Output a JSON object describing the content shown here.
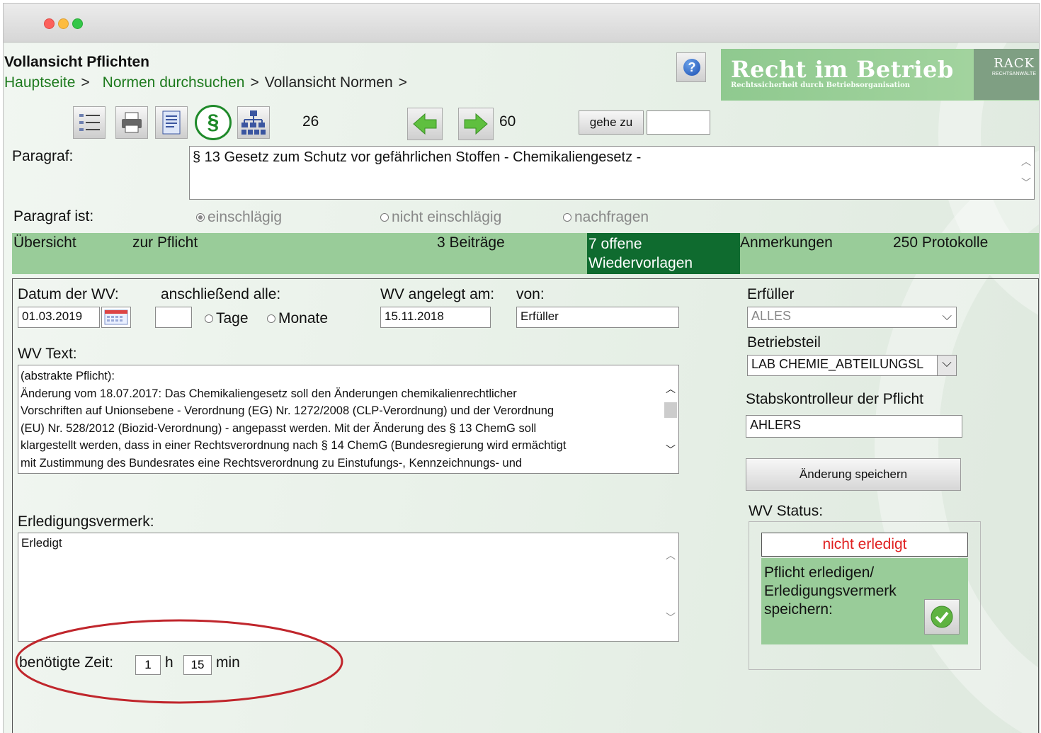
{
  "colors": {
    "accent_green": "#99cc99",
    "active_tab": "#0f6b2f",
    "link_green": "#1d7a1d",
    "status_red": "#e02020",
    "oval_red": "#c0262c"
  },
  "header": {
    "title": "Vollansicht Pflichten",
    "breadcrumb": [
      {
        "label": "Hauptseite",
        "sep": ">"
      },
      {
        "label": "Normen durchsuchen",
        "sep": ">"
      },
      {
        "label": "Vollansicht Normen",
        "sep": ">"
      }
    ],
    "help_glyph": "?",
    "logo": {
      "title": "Recht im Betrieb",
      "tagline": "Rechtssicherheit durch Betriebsorganisation",
      "brand": "RACK",
      "brand_sub": "RECHTSANWÄLTE"
    }
  },
  "toolbar": {
    "icons": [
      "list-icon",
      "printer-icon",
      "document-icon",
      "paragraph-icon",
      "org-chart-icon"
    ],
    "paragraph_symbol": "§",
    "current_number": "26",
    "total_number": "60",
    "goto_label": "gehe zu",
    "goto_value": ""
  },
  "paragraph": {
    "label": "Paragraf:",
    "value": "§ 13 Gesetz zum Schutz vor gefährlichen Stoffen - Chemikaliengesetz -",
    "status_label": "Paragraf ist:",
    "options": [
      {
        "label": "einschlägig",
        "selected": true
      },
      {
        "label": "nicht einschlägig",
        "selected": false
      },
      {
        "label": "nachfragen",
        "selected": false
      }
    ]
  },
  "tabs": [
    {
      "label": "Übersicht"
    },
    {
      "label": "zur Pflicht"
    },
    {
      "label": "3 Beiträge"
    },
    {
      "label": "7 offene Wiedervorlagen",
      "active": true
    },
    {
      "label": "Anmerkungen"
    },
    {
      "label": "250 Protokolle"
    }
  ],
  "form": {
    "date_label": "Datum der WV:",
    "date_value": "01.03.2019",
    "then_all_label": "anschließend alle:",
    "interval_value": "",
    "unit_options": [
      {
        "label": "Tage"
      },
      {
        "label": "Monate"
      }
    ],
    "created_label": "WV angelegt am:",
    "created_value": "15.11.2018",
    "from_label": "von:",
    "from_value": "Erfüller",
    "wv_text_label": "WV Text:",
    "wv_text_lines": [
      "(abstrakte Pflicht):",
      "Änderung vom 18.07.2017: Das Chemikaliengesetz soll den Änderungen chemikalienrechtlicher",
      "Vorschriften auf Unionsebene - Verordnung (EG) Nr. 1272/2008 (CLP-Verordnung) und der Verordnung",
      "(EU) Nr. 528/2012 (Biozid-Verordnung) - angepasst werden. Mit der Änderung des § 13 ChemG soll",
      "klargestellt werden, dass in einer Rechtsverordnung nach § 14 ChemG (Bundesregierung wird ermächtigt",
      "mit Zustimmung des Bundesrates eine  Rechtsverordnung zu Einstufungs-, Kennzeichnungs- und"
    ],
    "completion_label": "Erledigungsvermerk:",
    "completion_value": "Erledigt",
    "time_label": "benötigte Zeit:",
    "hours_value": "1",
    "hours_unit": "h",
    "minutes_value": "15",
    "minutes_unit": "min"
  },
  "right_panel": {
    "fulfiller_label": "Erfüller",
    "fulfiller_value": "ALLES",
    "department_label": "Betriebsteil",
    "department_value": "LAB CHEMIE_ABTEILUNGSL",
    "controller_label": "Stabskontrolleur der Pflicht",
    "controller_value": "AHLERS",
    "save_button": "Änderung speichern",
    "status_label": "WV Status:",
    "status_value": "nicht erledigt",
    "complete_text_lines": [
      "Pflicht erledigen/",
      "Erledigungsvermerk",
      "speichern:"
    ]
  }
}
